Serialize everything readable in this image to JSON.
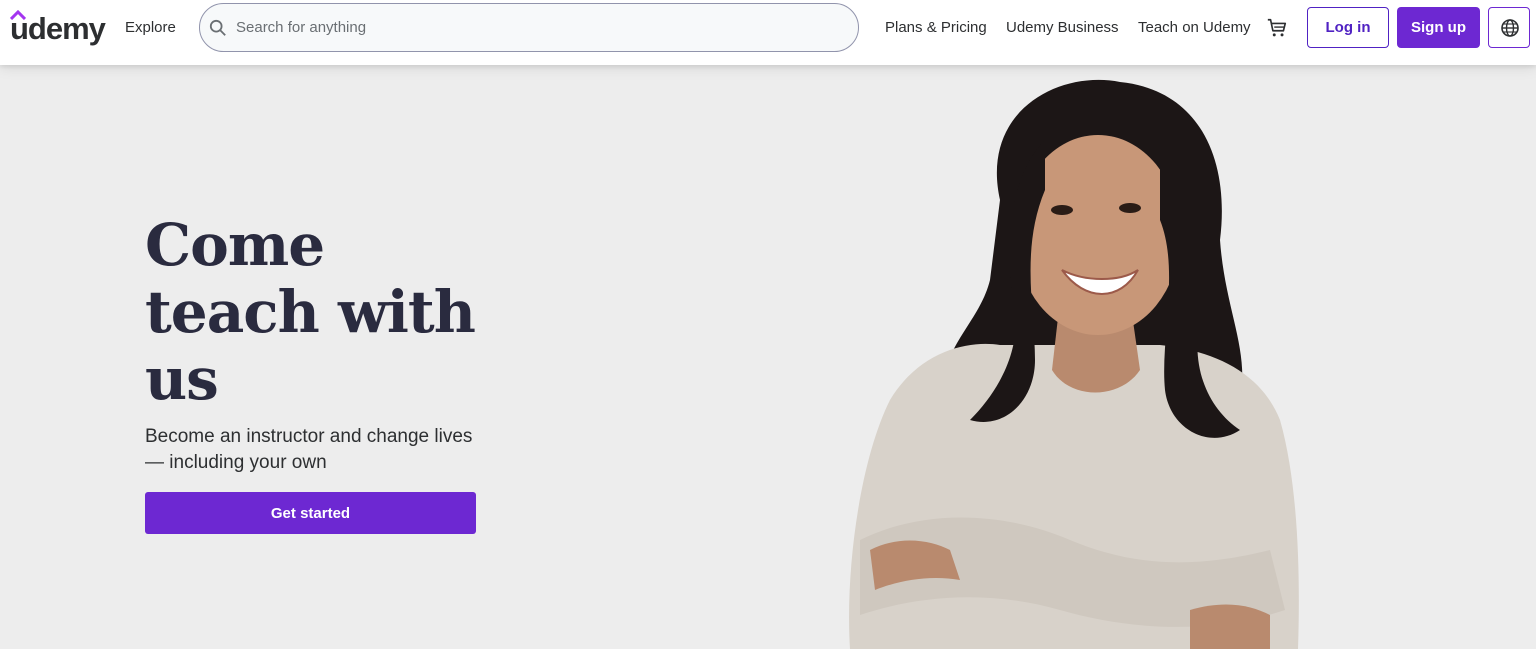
{
  "header": {
    "logo_text": "udemy",
    "explore_label": "Explore",
    "search": {
      "placeholder": "Search for anything"
    },
    "nav": {
      "plans_pricing": "Plans & Pricing",
      "udemy_business": "Udemy Business",
      "teach": "Teach on Udemy"
    },
    "login_label": "Log in",
    "signup_label": "Sign up",
    "icons": {
      "search": "search-icon",
      "cart": "cart-icon",
      "language": "globe-icon"
    }
  },
  "hero": {
    "title_line1": "Come",
    "title_line2": "teach with",
    "title_line3": "us",
    "subtitle_line1": "Become an instructor and change lives",
    "subtitle_line2": "— including your own",
    "cta_label": "Get started"
  },
  "colors": {
    "brand_purple": "#6d28d2",
    "login_purple": "#5022c3",
    "hero_background": "#ededed",
    "heading": "#2a2b3f"
  }
}
